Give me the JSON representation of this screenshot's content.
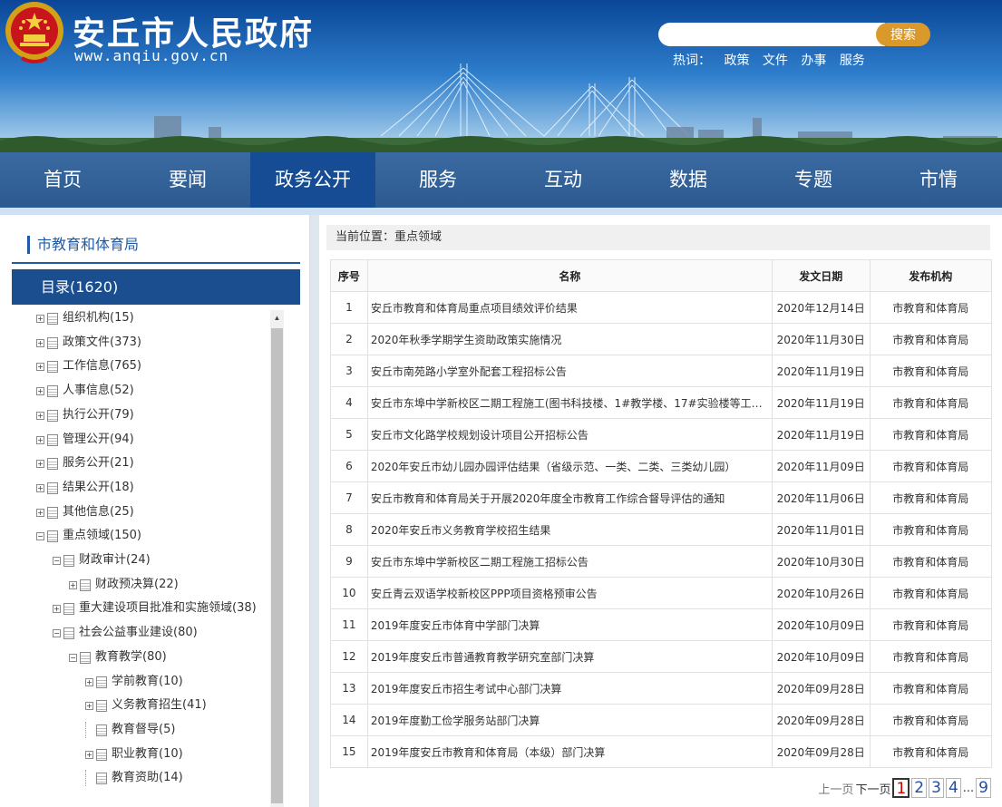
{
  "header": {
    "site_title": "安丘市人民政府",
    "site_url": "www.anqiu.gov.cn",
    "search_placeholder": "",
    "search_button": "搜索",
    "hotwords_label": "热词：",
    "hotwords": [
      "政策",
      "文件",
      "办事",
      "服务"
    ]
  },
  "nav": {
    "items": [
      "首页",
      "要闻",
      "政务公开",
      "服务",
      "互动",
      "数据",
      "专题",
      "市情"
    ],
    "active": "政务公开"
  },
  "sidebar": {
    "department": "市教育和体育局",
    "catalog_label": "目录(1620)",
    "tree": [
      {
        "label": "组织机构(15)",
        "level": 0,
        "expander": "+"
      },
      {
        "label": "政策文件(373)",
        "level": 0,
        "expander": "+"
      },
      {
        "label": "工作信息(765)",
        "level": 0,
        "expander": "+"
      },
      {
        "label": "人事信息(52)",
        "level": 0,
        "expander": "+"
      },
      {
        "label": "执行公开(79)",
        "level": 0,
        "expander": "+"
      },
      {
        "label": "管理公开(94)",
        "level": 0,
        "expander": "+"
      },
      {
        "label": "服务公开(21)",
        "level": 0,
        "expander": "+"
      },
      {
        "label": "结果公开(18)",
        "level": 0,
        "expander": "+"
      },
      {
        "label": "其他信息(25)",
        "level": 0,
        "expander": "+"
      },
      {
        "label": "重点领域(150)",
        "level": 0,
        "expander": "-"
      },
      {
        "label": "财政审计(24)",
        "level": 1,
        "expander": "-"
      },
      {
        "label": "财政预决算(22)",
        "level": 2,
        "expander": "+"
      },
      {
        "label": "重大建设项目批准和实施领域(38)",
        "level": 1,
        "expander": "+"
      },
      {
        "label": "社会公益事业建设(80)",
        "level": 1,
        "expander": "-"
      },
      {
        "label": "教育教学(80)",
        "level": 2,
        "expander": "-"
      },
      {
        "label": "学前教育(10)",
        "level": 3,
        "expander": "+"
      },
      {
        "label": "义务教育招生(41)",
        "level": 3,
        "expander": "+"
      },
      {
        "label": "教育督导(5)",
        "level": 3,
        "expander": ""
      },
      {
        "label": "职业教育(10)",
        "level": 3,
        "expander": "+"
      },
      {
        "label": "教育资助(14)",
        "level": 3,
        "expander": ""
      }
    ]
  },
  "main": {
    "breadcrumb": "当前位置：重点领域",
    "columns": [
      "序号",
      "名称",
      "发文日期",
      "发布机构"
    ],
    "rows": [
      [
        "1",
        "安丘市教育和体育局重点项目绩效评价结果",
        "2020年12月14日",
        "市教育和体育局"
      ],
      [
        "2",
        "2020年秋季学期学生资助政策实施情况",
        "2020年11月30日",
        "市教育和体育局"
      ],
      [
        "3",
        "安丘市南苑路小学室外配套工程招标公告",
        "2020年11月19日",
        "市教育和体育局"
      ],
      [
        "4",
        "安丘市东埠中学新校区二期工程施工(图书科技楼、1#教学楼、17#实验楼等工程...",
        "2020年11月19日",
        "市教育和体育局"
      ],
      [
        "5",
        "安丘市文化路学校规划设计项目公开招标公告",
        "2020年11月19日",
        "市教育和体育局"
      ],
      [
        "6",
        "2020年安丘市幼儿园办园评估结果（省级示范、一类、二类、三类幼儿园）",
        "2020年11月09日",
        "市教育和体育局"
      ],
      [
        "7",
        "安丘市教育和体育局关于开展2020年度全市教育工作综合督导评估的通知",
        "2020年11月06日",
        "市教育和体育局"
      ],
      [
        "8",
        "2020年安丘市义务教育学校招生结果",
        "2020年11月01日",
        "市教育和体育局"
      ],
      [
        "9",
        "安丘市东埠中学新校区二期工程施工招标公告",
        "2020年10月30日",
        "市教育和体育局"
      ],
      [
        "10",
        "安丘青云双语学校新校区PPP项目资格预审公告",
        "2020年10月26日",
        "市教育和体育局"
      ],
      [
        "11",
        "2019年度安丘市体育中学部门决算",
        "2020年10月09日",
        "市教育和体育局"
      ],
      [
        "12",
        "2019年度安丘市普通教育教学研究室部门决算",
        "2020年10月09日",
        "市教育和体育局"
      ],
      [
        "13",
        "2019年度安丘市招生考试中心部门决算",
        "2020年09月28日",
        "市教育和体育局"
      ],
      [
        "14",
        "2019年度勤工俭学服务站部门决算",
        "2020年09月28日",
        "市教育和体育局"
      ],
      [
        "15",
        "2019年度安丘市教育和体育局（本级）部门决算",
        "2020年09月28日",
        "市教育和体育局"
      ]
    ]
  },
  "pager": {
    "prev": "上一页",
    "next": "下一页",
    "pages": [
      "1",
      "2",
      "3",
      "4"
    ],
    "current": "1",
    "ellipsis": "...",
    "last": "9"
  }
}
